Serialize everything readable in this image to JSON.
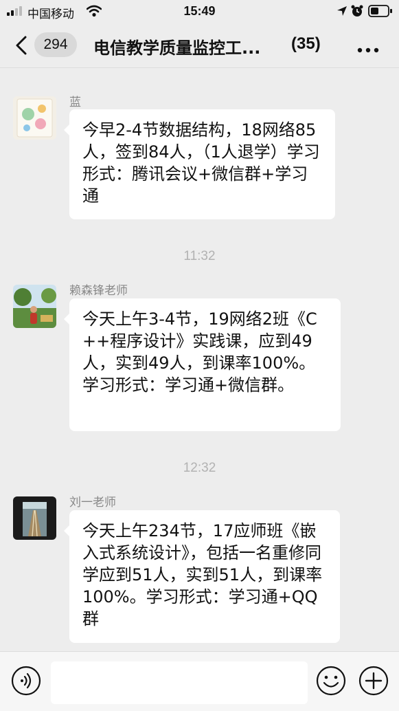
{
  "status_bar": {
    "carrier": "中国移动",
    "time": "15:49"
  },
  "nav": {
    "unread_count": "294",
    "title": "电信教学质量监控工...",
    "member_count": "(35)"
  },
  "messages": [
    {
      "sender": "蓝",
      "text": "今早2-4节数据结构，18网络85人，签到84人，（1人退学）学习形式：腾讯会议+微信群+学习通"
    },
    {
      "timestamp": "11:32",
      "sender": "赖森锋老师",
      "text": "今天上午3-4节，19网络2班《C++程序设计》实践课，应到49人，实到49人，到课率100%。学习形式：学习通+微信群。"
    },
    {
      "timestamp": "12:32",
      "sender": "刘一老师",
      "text": "今天上午234节，17应师班《嵌入式系统设计》，包括一名重修同学应到51人，实到51人，到课率100%。学习形式：学习通+QQ群"
    }
  ],
  "icons": {
    "back": "back-chevron-icon",
    "more": "more-dots-icon",
    "voice": "voice-icon",
    "emoji": "emoji-icon",
    "add": "plus-icon",
    "wifi": "wifi-icon",
    "location": "location-icon",
    "alarm": "alarm-icon",
    "battery": "battery-icon"
  },
  "colors": {
    "background": "#ededed",
    "bubble": "#ffffff",
    "timestamp_text": "#b2b2b2",
    "sender_text": "#888888"
  }
}
